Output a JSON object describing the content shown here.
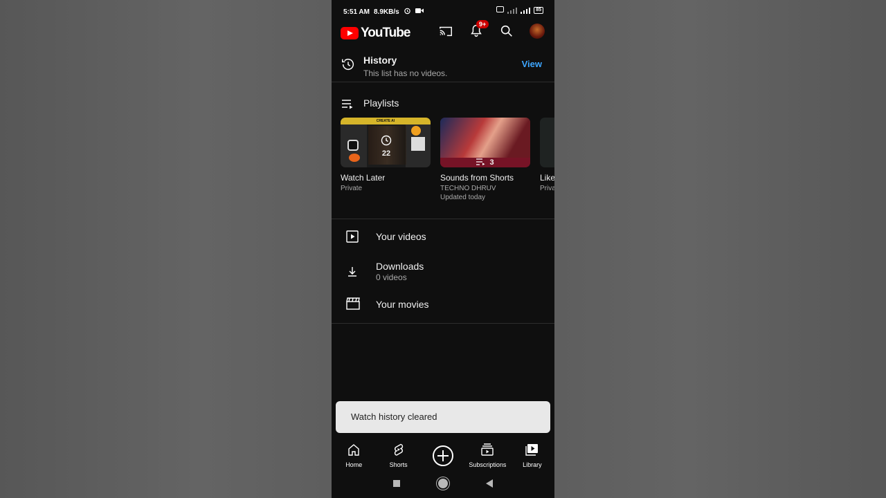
{
  "status_bar": {
    "time": "5:51 AM",
    "speed": "8.9KB/s",
    "battery": "85"
  },
  "app_bar": {
    "logo_text": "YouTube",
    "notification_badge": "9+"
  },
  "history": {
    "title": "History",
    "subtitle": "This list has no videos.",
    "view_label": "View"
  },
  "playlists": {
    "title": "Playlists",
    "items": [
      {
        "title": "Watch Later",
        "meta1": "Private",
        "meta2": "",
        "count": "22",
        "banner": "CREATE AI"
      },
      {
        "title": "Sounds from Shorts",
        "meta1": "TECHNO DHRUV",
        "meta2": "Updated today",
        "count": "3"
      },
      {
        "title": "Like",
        "meta1": "Priva",
        "meta2": ""
      }
    ]
  },
  "menu": {
    "your_videos": "Your videos",
    "downloads": "Downloads",
    "downloads_sub": "0 videos",
    "your_movies": "Your movies"
  },
  "snackbar": {
    "text": "Watch history cleared"
  },
  "bottom_nav": {
    "home": "Home",
    "shorts": "Shorts",
    "subscriptions": "Subscriptions",
    "library": "Library"
  },
  "colors": {
    "background": "#0f0f0f",
    "accent_link": "#3ea6ff",
    "brand_red": "#ff0000",
    "badge_red": "#cc0000"
  }
}
